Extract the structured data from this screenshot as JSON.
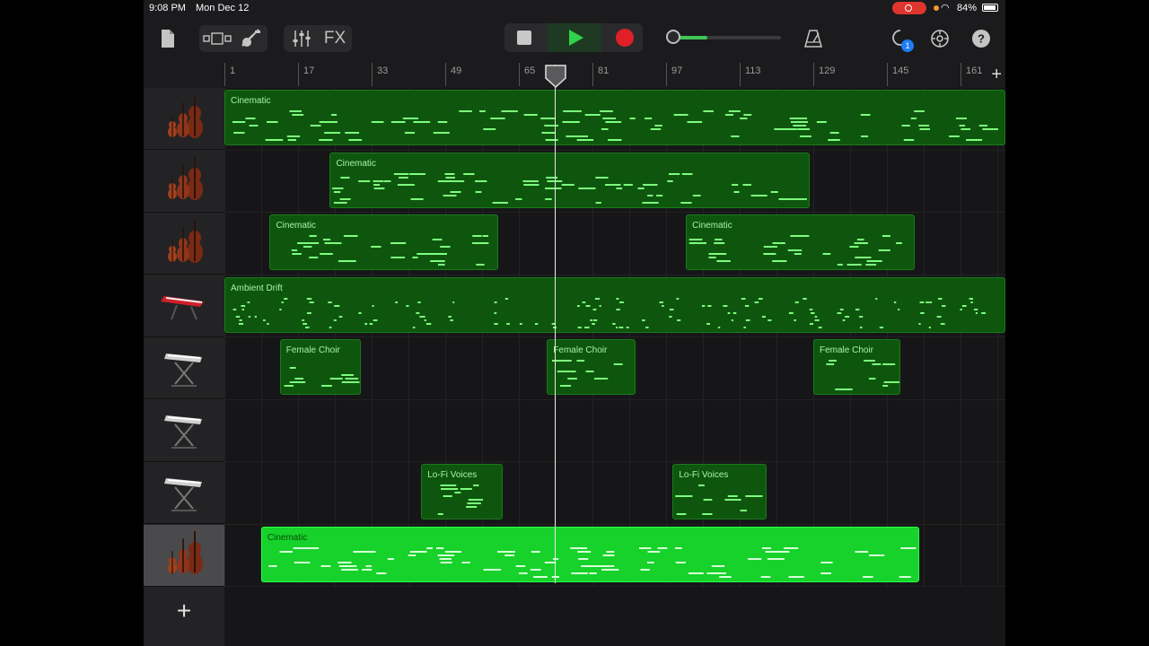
{
  "status": {
    "time": "9:08 PM",
    "date": "Mon Dec 12",
    "battery": "84%"
  },
  "toolbar": {
    "icons": [
      "document-icon",
      "tracks-view-icon",
      "instrument-icon",
      "mixer-icon",
      "loop-browser-icon",
      "metronome-icon",
      "settings-icon",
      "help-icon"
    ],
    "fx_label": "FX",
    "notification_count": "1",
    "volume_level": 0.35
  },
  "ruler": {
    "bars": [
      "1",
      "17",
      "33",
      "49",
      "65",
      "81",
      "97",
      "113",
      "129",
      "145",
      "161"
    ]
  },
  "tracks": [
    {
      "instrument": "strings-icon",
      "regions": [
        {
          "name": "Cinematic",
          "start": 0,
          "end": 1
        }
      ]
    },
    {
      "instrument": "strings-icon",
      "regions": [
        {
          "name": "Cinematic",
          "start": 0.135,
          "end": 0.75
        }
      ]
    },
    {
      "instrument": "strings-icon",
      "regions": [
        {
          "name": "Cinematic",
          "start": 0.058,
          "end": 0.351
        },
        {
          "name": "Cinematic",
          "start": 0.591,
          "end": 0.884
        }
      ]
    },
    {
      "instrument": "keyboard-red-icon",
      "regions": [
        {
          "name": "Ambient Drift",
          "start": 0,
          "end": 1
        }
      ]
    },
    {
      "instrument": "keyboard-stand-icon",
      "regions": [
        {
          "name": "Female Choir",
          "start": 0.071,
          "end": 0.175
        },
        {
          "name": "Female Choir",
          "start": 0.413,
          "end": 0.526
        },
        {
          "name": "Female Choir",
          "start": 0.754,
          "end": 0.865
        }
      ]
    },
    {
      "instrument": "keyboard-stand-icon",
      "regions": []
    },
    {
      "instrument": "keyboard-stand-icon",
      "regions": [
        {
          "name": "Lo-Fi Voices",
          "start": 0.252,
          "end": 0.356
        },
        {
          "name": "Lo-Fi Voices",
          "start": 0.574,
          "end": 0.694
        }
      ]
    },
    {
      "instrument": "strings-icon",
      "selected": true,
      "regions": [
        {
          "name": "Cinematic",
          "start": 0.047,
          "end": 0.89,
          "bright": true
        }
      ]
    }
  ],
  "add_track_label": "+",
  "playhead_bar": 68.5,
  "colors": {
    "region": "#0e560e",
    "region_selected": "#16d22a",
    "play": "#2fd24a",
    "record": "#e01f26"
  }
}
